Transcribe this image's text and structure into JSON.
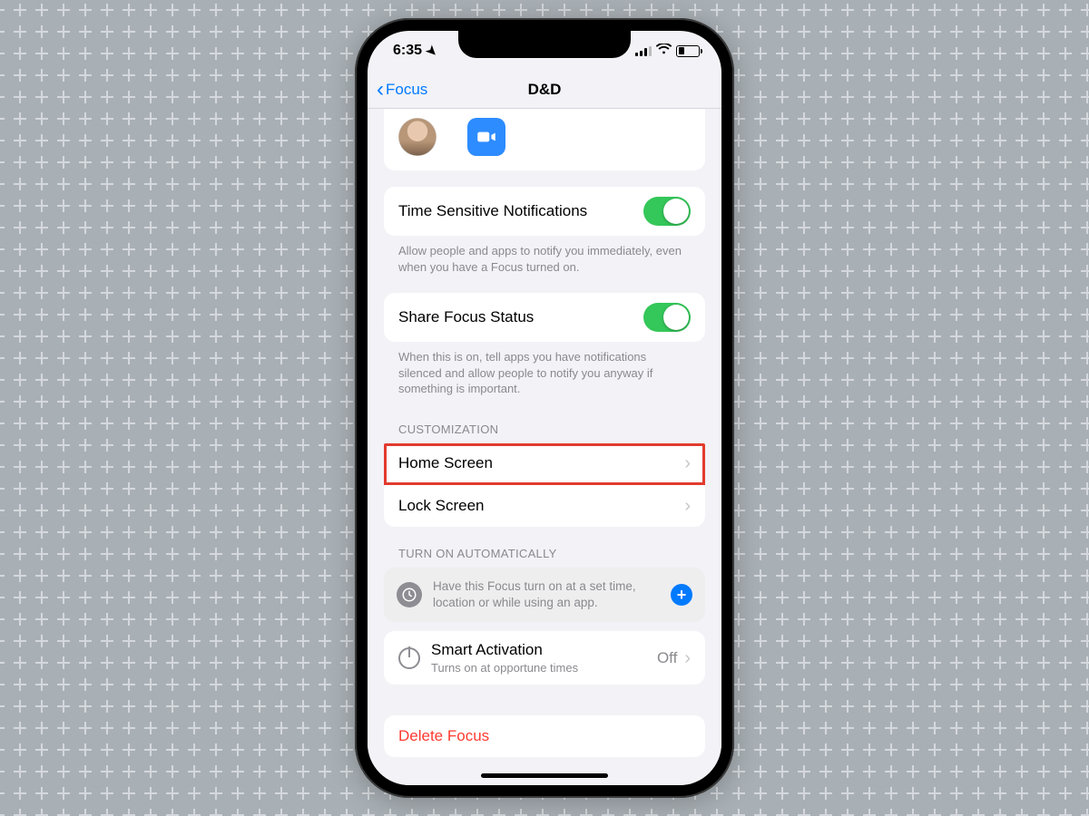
{
  "statusBar": {
    "time": "6:35",
    "locationIcon": "location-arrow"
  },
  "nav": {
    "backLabel": "Focus",
    "title": "D&D"
  },
  "allowed": {
    "personIcon": "contact-avatar",
    "appName": "zoom-app-icon"
  },
  "timeSensitive": {
    "label": "Time Sensitive Notifications",
    "enabled": true,
    "footer": "Allow people and apps to notify you immediately, even when you have a Focus turned on."
  },
  "shareStatus": {
    "label": "Share Focus Status",
    "enabled": true,
    "footer": "When this is on, tell apps you have notifications silenced and allow people to notify you anyway if something is important."
  },
  "sections": {
    "customization": "CUSTOMIZATION",
    "automation": "TURN ON AUTOMATICALLY"
  },
  "customization": {
    "homeScreen": "Home Screen",
    "lockScreen": "Lock Screen"
  },
  "automation": {
    "info": "Have this Focus turn on at a set time, location or while using an app.",
    "smartActivation": {
      "label": "Smart Activation",
      "sub": "Turns on at opportune times",
      "value": "Off"
    }
  },
  "delete": {
    "label": "Delete Focus"
  }
}
